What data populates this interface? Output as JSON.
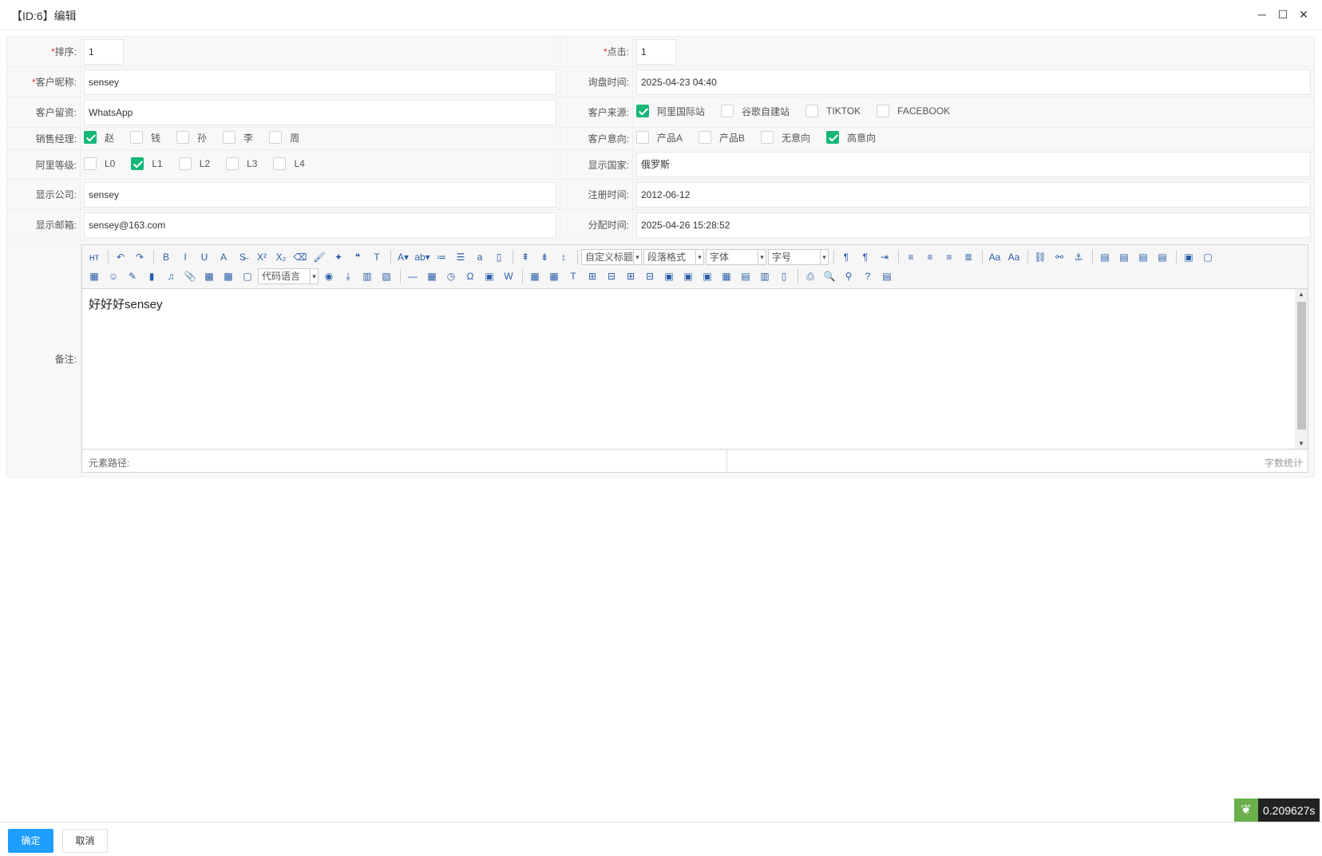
{
  "window": {
    "title": "【ID:6】编辑",
    "minimize": "─",
    "maximize": "☐",
    "close": "✕"
  },
  "form": {
    "sort": {
      "label": "排序:",
      "value": "1"
    },
    "clicks": {
      "label": "点击:",
      "value": "1"
    },
    "nickname": {
      "label": "客户昵称:",
      "value": "sensey"
    },
    "inquiry_time": {
      "label": "询盘时间:",
      "value": "2025-04-23 04:40"
    },
    "contact": {
      "label": "客户留资:",
      "value": "WhatsApp"
    },
    "source": {
      "label": "客户来源:",
      "options": [
        {
          "label": "阿里国际站",
          "checked": true
        },
        {
          "label": "谷歌自建站",
          "checked": false
        },
        {
          "label": "TIKTOK",
          "checked": false
        },
        {
          "label": "FACEBOOK",
          "checked": false
        }
      ]
    },
    "manager": {
      "label": "销售经理:",
      "options": [
        {
          "label": "赵",
          "checked": true
        },
        {
          "label": "钱",
          "checked": false
        },
        {
          "label": "孙",
          "checked": false
        },
        {
          "label": "李",
          "checked": false
        },
        {
          "label": "周",
          "checked": false
        }
      ]
    },
    "intent": {
      "label": "客户意向:",
      "options": [
        {
          "label": "产品A",
          "checked": false
        },
        {
          "label": "产品B",
          "checked": false
        },
        {
          "label": "无意向",
          "checked": false
        },
        {
          "label": "高意向",
          "checked": true
        }
      ]
    },
    "ali_level": {
      "label": "阿里等级:",
      "options": [
        {
          "label": "L0",
          "checked": false
        },
        {
          "label": "L1",
          "checked": true
        },
        {
          "label": "L2",
          "checked": false
        },
        {
          "label": "L3",
          "checked": false
        },
        {
          "label": "L4",
          "checked": false
        }
      ]
    },
    "country": {
      "label": "显示国家:",
      "value": "俄罗斯"
    },
    "company": {
      "label": "显示公司:",
      "value": "sensey"
    },
    "reg_time": {
      "label": "注册时间:",
      "value": "2012-06-12"
    },
    "email": {
      "label": "显示邮箱:",
      "value": "sensey@163.com"
    },
    "assign_time": {
      "label": "分配时间:",
      "value": "2025-04-26 15:28:52"
    },
    "remark": {
      "label": "备注:",
      "content": "好好好sensey"
    }
  },
  "editor": {
    "selects": {
      "heading": "自定义标题",
      "paragraph": "段落格式",
      "font": "字体",
      "size": "字号",
      "code": "代码语言"
    },
    "status_path": "元素路径:",
    "word_count": "字数统计",
    "row1": [
      "html-icon",
      "|",
      "undo-icon",
      "redo-icon",
      "|",
      "bold-icon",
      "italic-icon",
      "underline-icon",
      "font-border-icon",
      "strikethrough-icon",
      "superscript-icon",
      "subscript-icon",
      "eraser-icon",
      "format-brush-icon",
      "auto-format-icon",
      "blockquote-icon",
      "paste-plain-icon",
      "|",
      "font-color-icon",
      "highlight-color-icon",
      "ordered-list-icon",
      "unordered-list-icon",
      "select-all-icon",
      "clear-doc-icon",
      "|",
      "row-spacing-top-icon",
      "row-spacing-bottom-icon",
      "line-height-icon",
      "|",
      "SEL:heading",
      "SEL:paragraph",
      "SEL:font",
      "SEL:size",
      "|",
      "ltr-icon",
      "rtl-icon",
      "indent-icon",
      "|",
      "align-left-icon",
      "align-center-icon",
      "align-right-icon",
      "justify-icon",
      "|",
      "uppercase-icon",
      "lowercase-icon",
      "|",
      "link-icon",
      "unlink-icon",
      "anchor-icon",
      "|",
      "image-none-icon",
      "image-left-icon",
      "image-right-icon",
      "image-center-icon",
      "|",
      "insert-image-icon",
      "insert-frame-icon"
    ],
    "row2": [
      "multi-image-icon",
      "emotion-icon",
      "scrawl-icon",
      "video-icon",
      "music-icon",
      "attachment-icon",
      "map-icon",
      "gmap-icon",
      "insert-frame-icon",
      "SEL:code",
      "webapp-icon",
      "page-break-icon",
      "template-icon",
      "background-icon",
      "|",
      "horizontal-rule-icon",
      "date-icon",
      "time-icon",
      "special-char-icon",
      "wordimage-icon",
      "word-icon",
      "|",
      "insert-table-icon",
      "delete-table-icon",
      "table-title-icon",
      "insert-row-icon",
      "delete-row-icon",
      "insert-col-icon",
      "delete-col-icon",
      "merge-cells-icon",
      "merge-right-icon",
      "merge-down-icon",
      "split-cells-icon",
      "split-rows-icon",
      "split-cols-icon",
      "chart-icon",
      "|",
      "print-icon",
      "preview-icon",
      "search-replace-icon",
      "help-icon",
      "drafts-icon"
    ]
  },
  "footer": {
    "confirm": "确定",
    "cancel": "取消"
  },
  "badge": {
    "time": "0.209627s"
  }
}
